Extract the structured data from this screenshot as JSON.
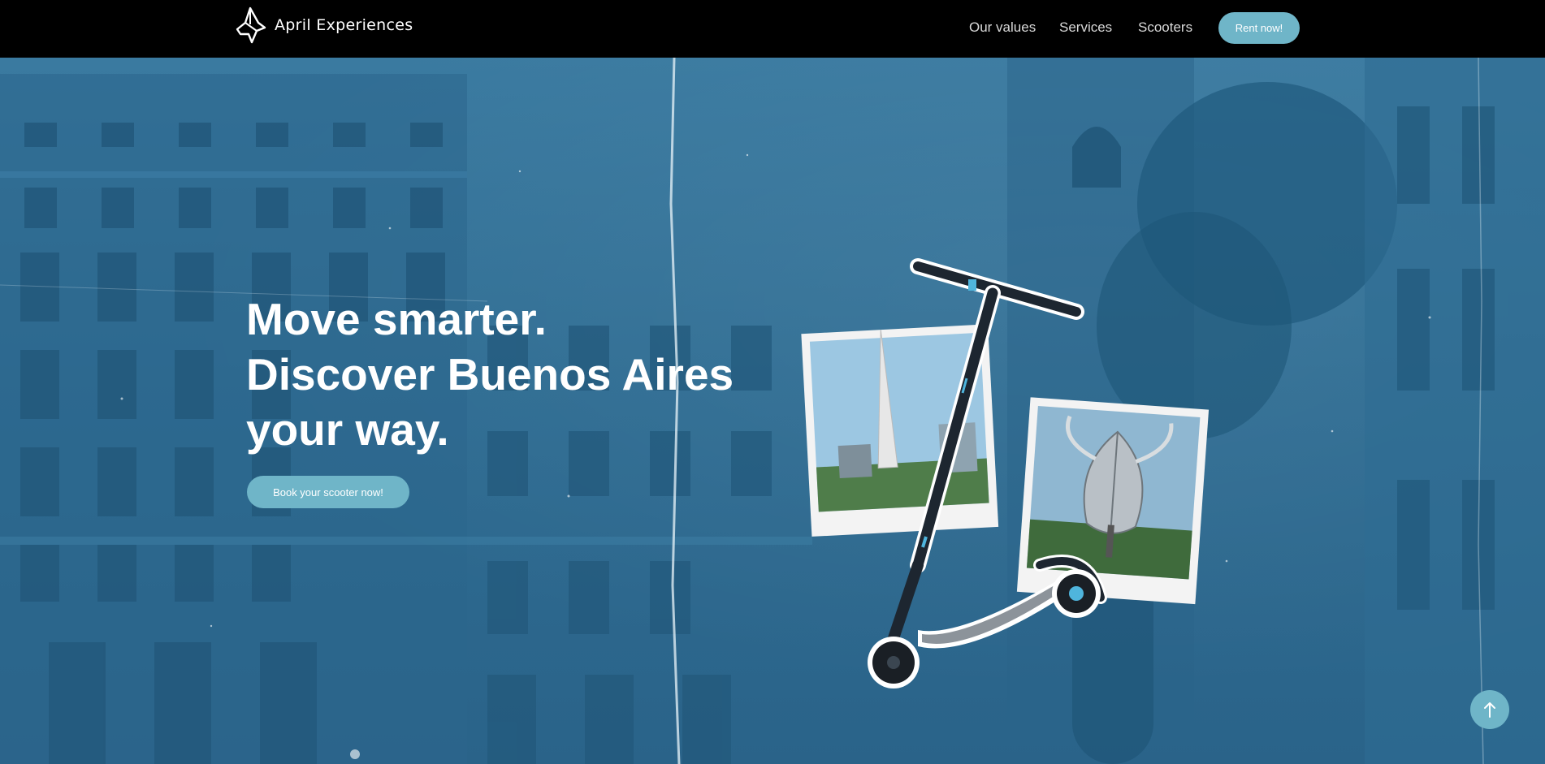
{
  "brand": {
    "name": "April Experiences",
    "logo_icon": "abstract-lotus-logo"
  },
  "nav": {
    "items": [
      {
        "label": "Our values"
      },
      {
        "label": "Services"
      },
      {
        "label": "Scooters"
      }
    ],
    "cta_label": "Rent now!"
  },
  "hero": {
    "headline_lines": [
      "Move smarter.",
      "Discover Buenos Aires",
      "your way."
    ],
    "cta_label": "Book your scooter now!",
    "background_image": "buenos-aires-building-blue-tint",
    "collage": {
      "photo_1": "obelisco-photo",
      "photo_2": "floralis-generica-photo",
      "scooter": "electric-scooter-image"
    }
  },
  "scroll_top": {
    "icon": "arrow-up-icon"
  },
  "colors": {
    "nav_bg": "#000000",
    "accent": "#6fb5c8",
    "hero_tint": "#2f6e93",
    "text": "#ffffff"
  }
}
